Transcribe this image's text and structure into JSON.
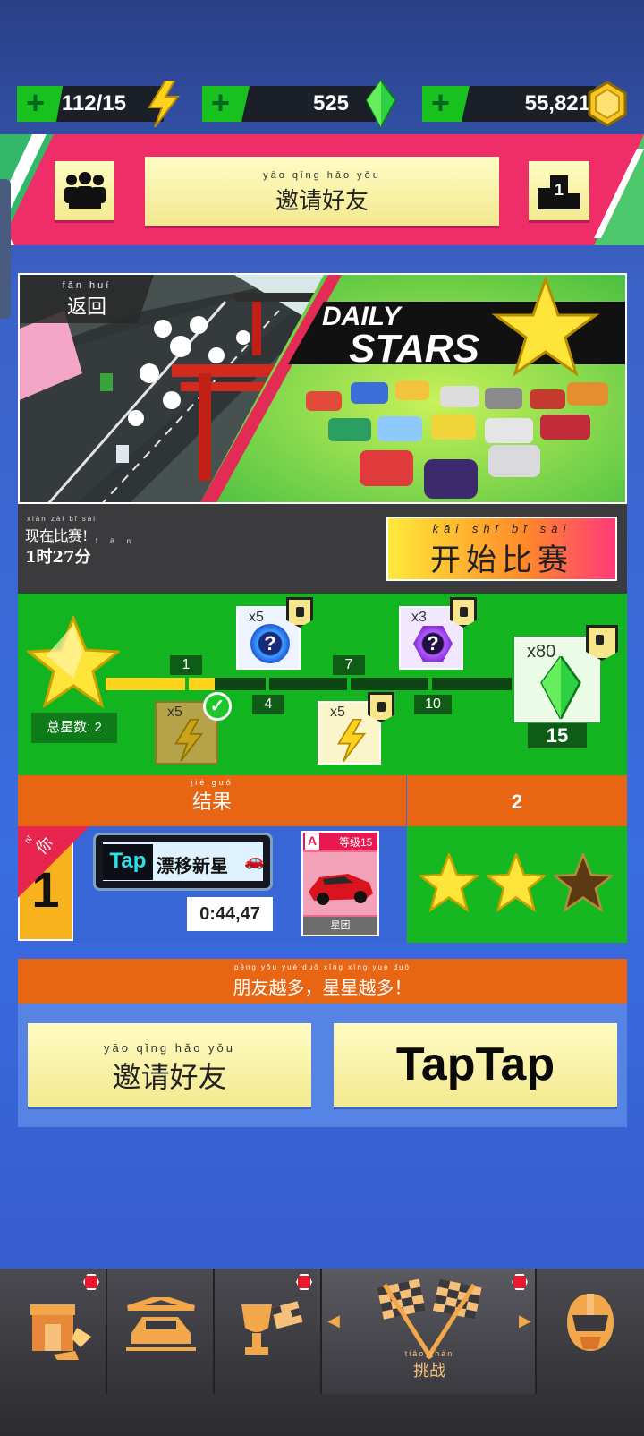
{
  "resources": {
    "energy": "112/15",
    "gems": "525",
    "coins": "55,821"
  },
  "top_band": {
    "invite": {
      "pinyin": "yāo qǐng hǎo yǒu",
      "label": "邀请好友"
    },
    "rank_number": "1"
  },
  "banner": {
    "back": {
      "pinyin": "fǎn huí",
      "label": "返回"
    },
    "title_line1": "DAILY",
    "title_line2": "STARS"
  },
  "event": {
    "now_pinyin": "xiàn zài bǐ sài",
    "now_label": "现在比赛!",
    "time_text": "1时27分",
    "time_pinyin": "shí fēn",
    "start_pinyin": "kāi shǐ bǐ sài",
    "start_label": "开始比赛"
  },
  "progress": {
    "stars_label": "总星数: 2",
    "stars_value": 2,
    "max_milestone": 15,
    "milestones": [
      "1",
      "4",
      "7",
      "10",
      "15"
    ],
    "rewards": [
      {
        "mult": "x5",
        "type": "energy",
        "claimed": true
      },
      {
        "mult": "x5",
        "type": "mystery-blue",
        "locked": true
      },
      {
        "mult": "x5",
        "type": "energy",
        "locked": true
      },
      {
        "mult": "x3",
        "type": "mystery-purple",
        "locked": true
      },
      {
        "mult": "x80",
        "type": "gem",
        "locked": true
      }
    ]
  },
  "results": {
    "header_pinyin": "jié guǒ",
    "header_label": "结果",
    "header_right": "2",
    "rank": "1",
    "rank_tag": "你",
    "rank_tag_pinyin": "nǐ",
    "player_tag_prefix": "Tap",
    "player_tag": "漂移新星",
    "time": "0:44,47",
    "car_class": "A",
    "car_level": "等级15",
    "car_name": "星团",
    "stars_earned": 2,
    "stars_total": 3
  },
  "footer": {
    "slogan_pinyin": "péng yǒu yuè duō   xīng xīng yuè duō",
    "slogan": "朋友越多，星星越多！",
    "invite": {
      "pinyin": "yāo qǐng hǎo yǒu",
      "label": "邀请好友"
    },
    "taptap": "TapTap"
  },
  "nav": {
    "items": [
      "shop",
      "garage",
      "cup",
      "challenge",
      "profile"
    ],
    "active_pinyin": "tiǎo zhàn",
    "active_label": "挑战"
  },
  "colors": {
    "accent_green": "#12b51f",
    "accent_orange": "#e86613",
    "accent_pink": "#ef2d68",
    "button_yellow": "#f8f1a6"
  }
}
